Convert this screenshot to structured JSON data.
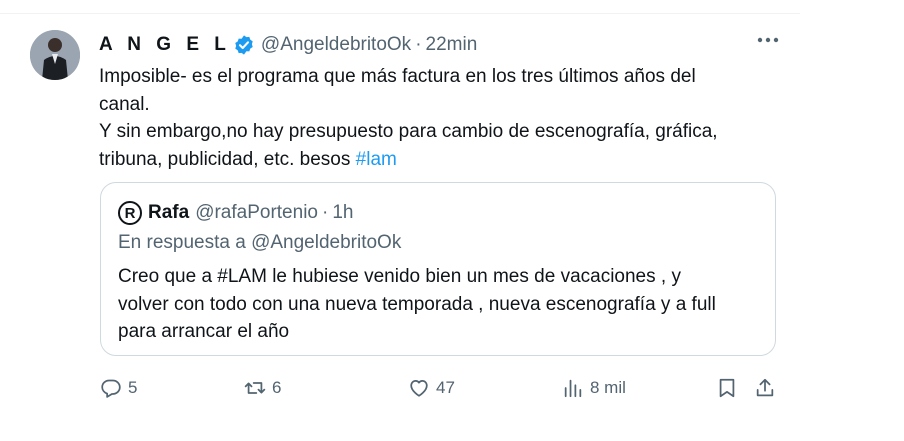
{
  "tweet": {
    "author_name": "A N G E L",
    "handle": "@AngeldebritoOk",
    "separator": "·",
    "time": "22min",
    "text_lines": [
      "Imposible- es el programa que más factura en los tres últimos años del",
      "canal.",
      "Y sin embargo,no hay presupuesto para cambio de escenografía, gráfica,",
      "tribuna, publicidad, etc. besos "
    ],
    "hashtag": "#lam"
  },
  "quote": {
    "avatar_letter": "R",
    "name": "Rafa",
    "handle": "@rafaPortenio",
    "separator": "·",
    "time": "1h",
    "reply_to": "En respuesta a @AngeldebritoOk",
    "text_lines": [
      "Creo que a #LAM le hubiese venido bien un mes de vacaciones , y",
      "volver con todo con una nueva temporada , nueva escenografía y a full",
      "para arrancar el año"
    ]
  },
  "actions": {
    "replies": "5",
    "retweets": "6",
    "likes": "47",
    "views": "8 mil"
  },
  "colors": {
    "accent": "#1d9bf0",
    "secondary_text": "#536471",
    "border": "#cfd9de"
  },
  "icons": [
    "verified-badge-icon",
    "more-icon",
    "reply-icon",
    "retweet-icon",
    "like-icon",
    "views-icon",
    "bookmark-icon",
    "share-icon"
  ]
}
